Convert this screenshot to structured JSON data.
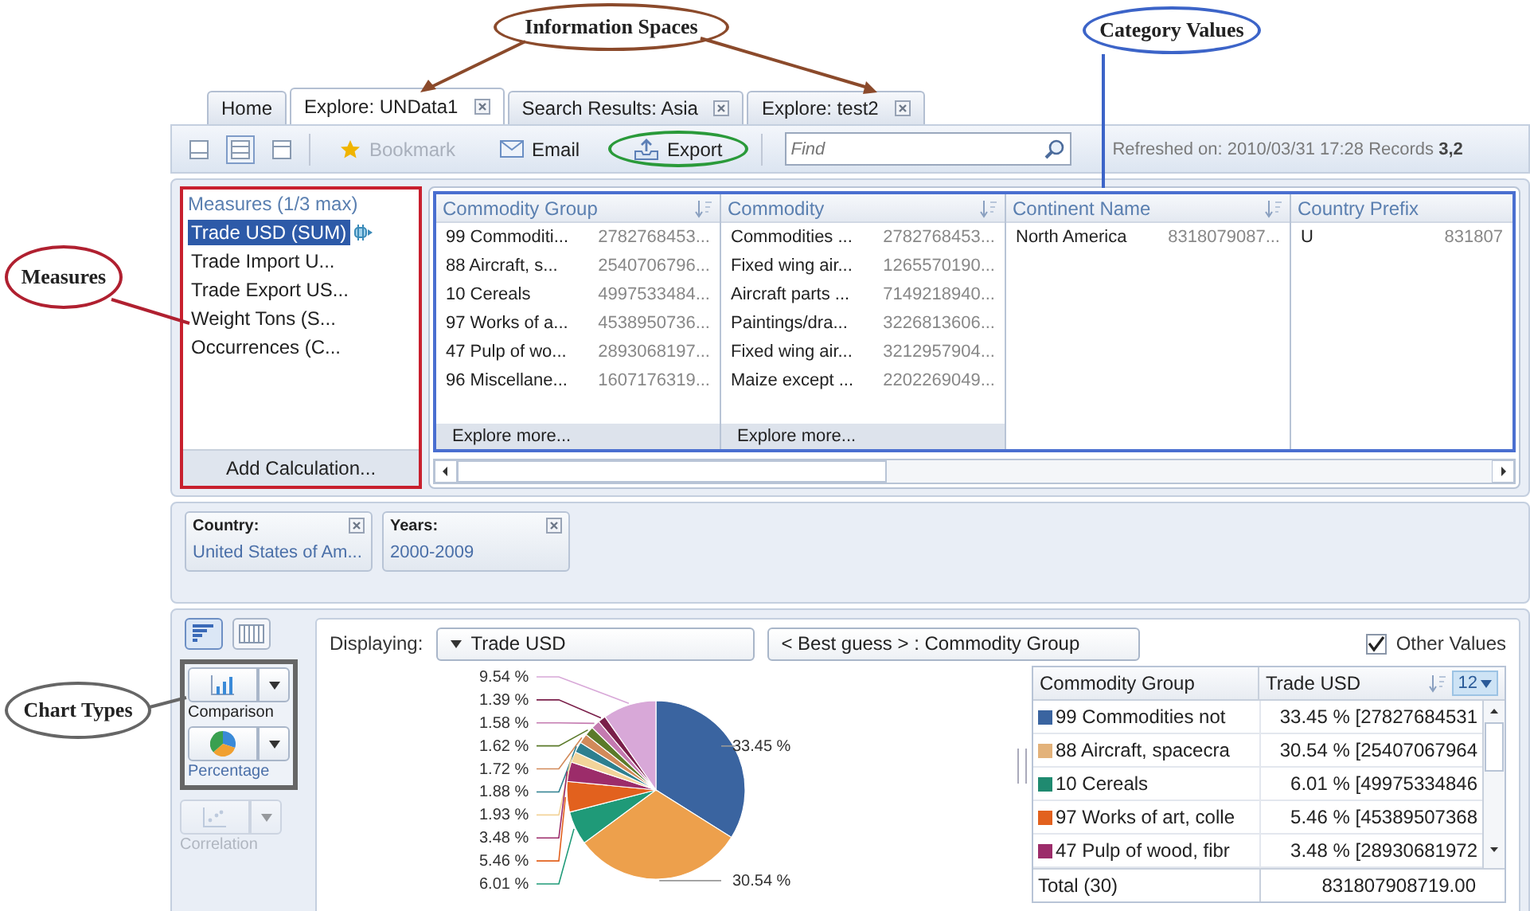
{
  "annotations": [
    {
      "text": "Information Spaces",
      "color": "#8b4a2b"
    },
    {
      "text": "Category Values",
      "color": "#3c64c8"
    },
    {
      "text": "Measures",
      "color": "#b02030"
    },
    {
      "text": "Chart Types",
      "color": "#666666"
    }
  ],
  "tabs": [
    {
      "label": "Home",
      "selected": false,
      "closable": false
    },
    {
      "label": "Explore: UNData1",
      "selected": true,
      "closable": true
    },
    {
      "label": "Search Results: Asia",
      "selected": false,
      "closable": true
    },
    {
      "label": "Explore: test2",
      "selected": false,
      "closable": true
    }
  ],
  "toolbar": {
    "layouts": [
      {
        "selected": false
      },
      {
        "selected": true
      },
      {
        "selected": false
      }
    ],
    "buttons": [
      {
        "label": "Bookmark",
        "kind": "bookmark",
        "disabled": true
      },
      {
        "label": "Email",
        "kind": "email",
        "disabled": false
      },
      {
        "label": "Export",
        "kind": "export",
        "disabled": false
      }
    ],
    "search": {
      "placeholder": "Find"
    },
    "status": "Refreshed on: 2010/03/31 17:28 Records **3,2**"
  },
  "measures": {
    "title": "Measures (1/3 max)",
    "items": [
      {
        "label": "Trade USD (SUM)",
        "selected": true
      },
      {
        "label": "Trade Import U...",
        "selected": false
      },
      {
        "label": "Trade Export US...",
        "selected": false
      },
      {
        "label": "Weight Tons (S...",
        "selected": false
      },
      {
        "label": "Occurrences (C...",
        "selected": false
      }
    ],
    "add_button": "Add Calculation..."
  },
  "category_columns": [
    {
      "title": "Commodity Group",
      "sortable": true,
      "more": "Explore more...",
      "rows": [
        {
          "label": "99 Commoditi...",
          "value": "2782768453..."
        },
        {
          "label": "88 Aircraft, s...",
          "value": "2540706796..."
        },
        {
          "label": "10 Cereals",
          "value": "4997533484..."
        },
        {
          "label": "97 Works of a...",
          "value": "4538950736..."
        },
        {
          "label": "47 Pulp of wo...",
          "value": "2893068197..."
        },
        {
          "label": "96 Miscellane...",
          "value": "1607176319..."
        }
      ]
    },
    {
      "title": "Commodity",
      "sortable": true,
      "more": "Explore more...",
      "rows": [
        {
          "label": "Commodities ...",
          "value": "2782768453..."
        },
        {
          "label": "Fixed wing air...",
          "value": "1265570190..."
        },
        {
          "label": "Aircraft parts ...",
          "value": "7149218940..."
        },
        {
          "label": "Paintings/dra...",
          "value": "3226813606..."
        },
        {
          "label": "Fixed wing air...",
          "value": "3212957904..."
        },
        {
          "label": "Maize except ...",
          "value": "2202269049..."
        }
      ]
    },
    {
      "title": "Continent Name",
      "sortable": true,
      "rows": [
        {
          "label": "North America",
          "value": "8318079087..."
        }
      ]
    },
    {
      "title": "Country Prefix",
      "sortable": false,
      "rows": [
        {
          "label": "U",
          "value": "831807"
        }
      ]
    }
  ],
  "filters": [
    {
      "title": "Country:",
      "value": "United States of Am..."
    },
    {
      "title": "Years:",
      "value": "2000-2009"
    }
  ],
  "view_toggles": [
    {
      "selected": true
    },
    {
      "selected": false
    }
  ],
  "chart_types": [
    {
      "label": "Comparison",
      "kind": "bar",
      "selected": false,
      "disabled": false
    },
    {
      "label": "Percentage",
      "kind": "pie",
      "selected": true,
      "disabled": false
    },
    {
      "label": "Correlation",
      "kind": "scatter",
      "selected": false,
      "disabled": true
    }
  ],
  "chart_panel": {
    "displaying_label": "Displaying:",
    "measure": "Trade USD",
    "dimension": "< Best guess > : Commodity Group",
    "other_values": {
      "label": "Other Values",
      "checked": true
    },
    "chart_data": {
      "type": "pie",
      "values": [
        33.45,
        30.54,
        6.01,
        5.46,
        3.48,
        1.93,
        1.88,
        1.72,
        1.62,
        1.58,
        1.39,
        9.54
      ],
      "value_labels": [
        "33.45 %",
        "30.54 %",
        "6.01 %",
        "5.46 %",
        "3.48 %",
        "1.93 %",
        "1.88 %",
        "1.72 %",
        "1.62 %",
        "1.58 %",
        "1.39 %",
        "9.54 %"
      ]
    },
    "legend_table": {
      "columns": [
        "Commodity Group",
        "Trade USD"
      ],
      "top_n": "12",
      "rows": [
        {
          "label": "99 Commodities not",
          "value": "33.45 % [27827684531",
          "color": "#3a64a0"
        },
        {
          "label": "88 Aircraft, spacecra",
          "value": "30.54 % [25407067964",
          "color": "#e3b27a"
        },
        {
          "label": "10 Cereals",
          "value": "6.01 % [49975334846",
          "color": "#1f8a70"
        },
        {
          "label": "97 Works of art, colle",
          "value": "5.46 % [45389507368",
          "color": "#e2611e"
        },
        {
          "label": "47 Pulp of wood, fibr",
          "value": "3.48 % [28930681972",
          "color": "#9c2c6a"
        }
      ],
      "total": {
        "label": "Total (30)",
        "value": "831807908719.00"
      }
    }
  }
}
